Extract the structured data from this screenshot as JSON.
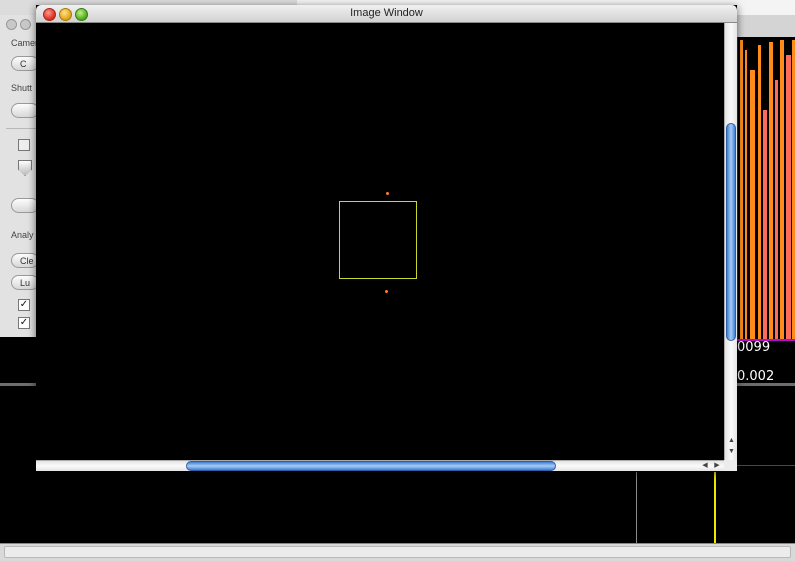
{
  "window": {
    "title": "Image Window"
  },
  "palette": {
    "camera_label": "Camer",
    "camera_button": "C",
    "shutter_label": "Shutt",
    "analysis_label": "Analy",
    "clear_button": "Cle",
    "lum_button": "Lu",
    "check_1": "✓",
    "check_2": "✓"
  },
  "readouts": {
    "value_1": "0099",
    "value_2": "0.002"
  },
  "plot": {
    "bar_colors": [
      "#ff8c1a",
      "#ff6b5a"
    ],
    "baseline_color": "#b010c8"
  },
  "colors": {
    "roi": "#c9d62a",
    "spot": "#ff7a2a",
    "scroll_thumb": "#3f7fd6"
  },
  "scroll": {
    "up_arrow": "▲",
    "down_arrow": "▼",
    "left_arrow": "◀",
    "right_arrow": "▶"
  }
}
